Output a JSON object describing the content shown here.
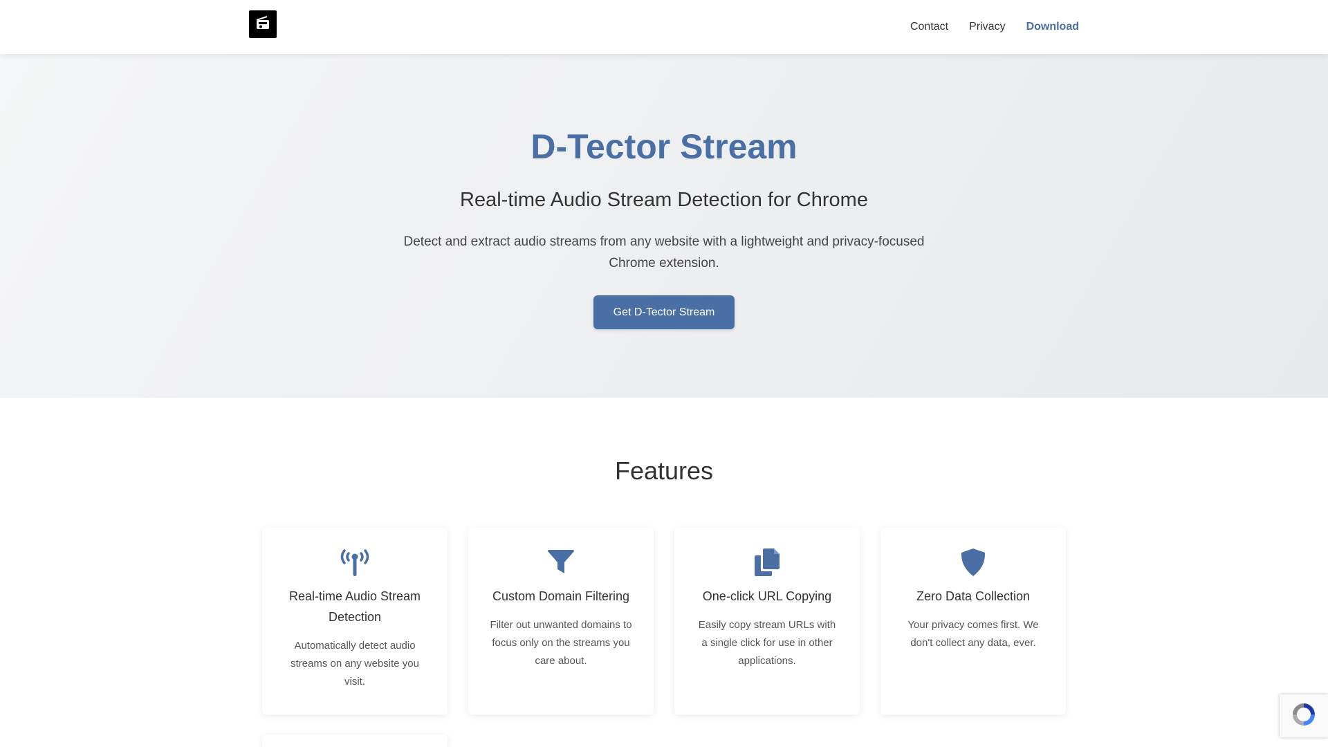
{
  "header": {
    "logo_icon": "radio-icon",
    "nav": {
      "contact": "Contact",
      "privacy": "Privacy",
      "download": "Download"
    }
  },
  "hero": {
    "title": "D-Tector Stream",
    "subtitle": "Real-time Audio Stream Detection for Chrome",
    "description": "Detect and extract audio streams from any website with a lightweight and privacy-focused Chrome extension.",
    "cta_label": "Get D-Tector Stream"
  },
  "features": {
    "title": "Features",
    "items": [
      {
        "icon": "antenna-icon",
        "title": "Real-time Audio Stream Detection",
        "description": "Automatically detect audio streams on any website you visit."
      },
      {
        "icon": "filter-icon",
        "title": "Custom Domain Filtering",
        "description": "Filter out unwanted domains to focus only on the streams you care about."
      },
      {
        "icon": "copy-icon",
        "title": "One-click URL Copying",
        "description": "Easily copy stream URLs with a single click for use in other applications."
      },
      {
        "icon": "shield-icon",
        "title": "Zero Data Collection",
        "description": "Your privacy comes first. We don't collect any data, ever."
      }
    ]
  },
  "colors": {
    "accent": "#4a6fa5",
    "text": "#333333",
    "hero_bg": "#eff0f2"
  },
  "recaptcha_icon": "recaptcha-icon"
}
